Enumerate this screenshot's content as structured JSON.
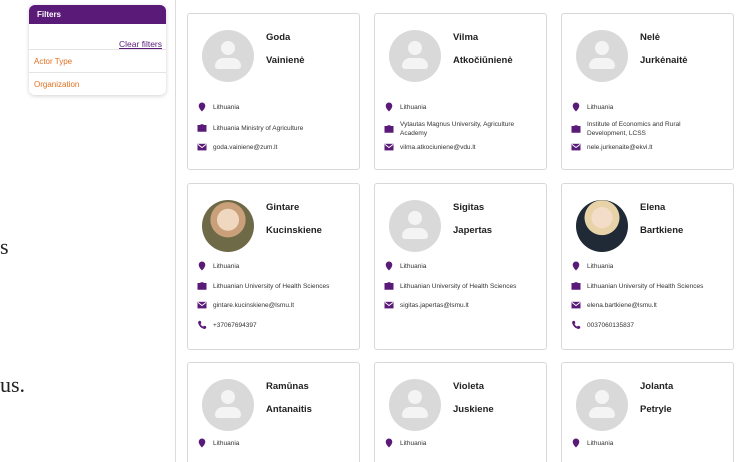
{
  "filters": {
    "title": "Filters",
    "clear_label": "Clear filters",
    "items": [
      "Actor Type",
      "Organization"
    ]
  },
  "background_text": [
    "s",
    "us."
  ],
  "colors": {
    "brand": "#5a1a78",
    "accent": "#e07020",
    "avatar_bg": "#d9d9d9"
  },
  "icons": [
    "location-pin-icon",
    "briefcase-icon",
    "envelope-icon",
    "phone-icon"
  ],
  "cards": [
    {
      "first_name": "Goda",
      "last_name": "Vainienė",
      "country": "Lithuania",
      "organization": "Lithuania Ministry of Agriculture",
      "email": "goda.vainiene@zum.lt",
      "phone": ""
    },
    {
      "first_name": "Vilma",
      "last_name": "Atkočiūnienė",
      "country": "Lithuania",
      "organization": "Vytautas Magnus University, Agriculture Academy",
      "email": "vilma.atkociuniene@vdu.lt",
      "phone": ""
    },
    {
      "first_name": "Nelė",
      "last_name": "Jurkėnaitė",
      "country": "Lithuania",
      "organization": "Institute of Economics and Rural Development, LCSS",
      "email": "nele.jurkenaite@ekvi.lt",
      "phone": ""
    },
    {
      "first_name": "Gintare",
      "last_name": "Kucinskiene",
      "country": "Lithuania",
      "organization": "Lithuanian University of Health Sciences",
      "email": "gintare.kucinskiene@lsmu.lt",
      "phone": "+37067694397"
    },
    {
      "first_name": "Sigitas",
      "last_name": "Japertas",
      "country": "Lithuania",
      "organization": "Lithuanian University of Health Sciences",
      "email": "sigitas.japertas@lsmu.lt",
      "phone": ""
    },
    {
      "first_name": "Elena",
      "last_name": "Bartkiene",
      "country": "Lithuania",
      "organization": "Lithuanian University of Health Sciences",
      "email": "elena.bartkiene@lsmu.lt",
      "phone": "0037060135837"
    },
    {
      "first_name": "Ramūnas",
      "last_name": "Antanaitis",
      "country": "Lithuania",
      "organization": "",
      "email": "",
      "phone": ""
    },
    {
      "first_name": "Violeta",
      "last_name": "Juskiene",
      "country": "Lithuania",
      "organization": "",
      "email": "",
      "phone": ""
    },
    {
      "first_name": "Jolanta",
      "last_name": "Petryle",
      "country": "Lithuania",
      "organization": "",
      "email": "",
      "phone": ""
    }
  ]
}
